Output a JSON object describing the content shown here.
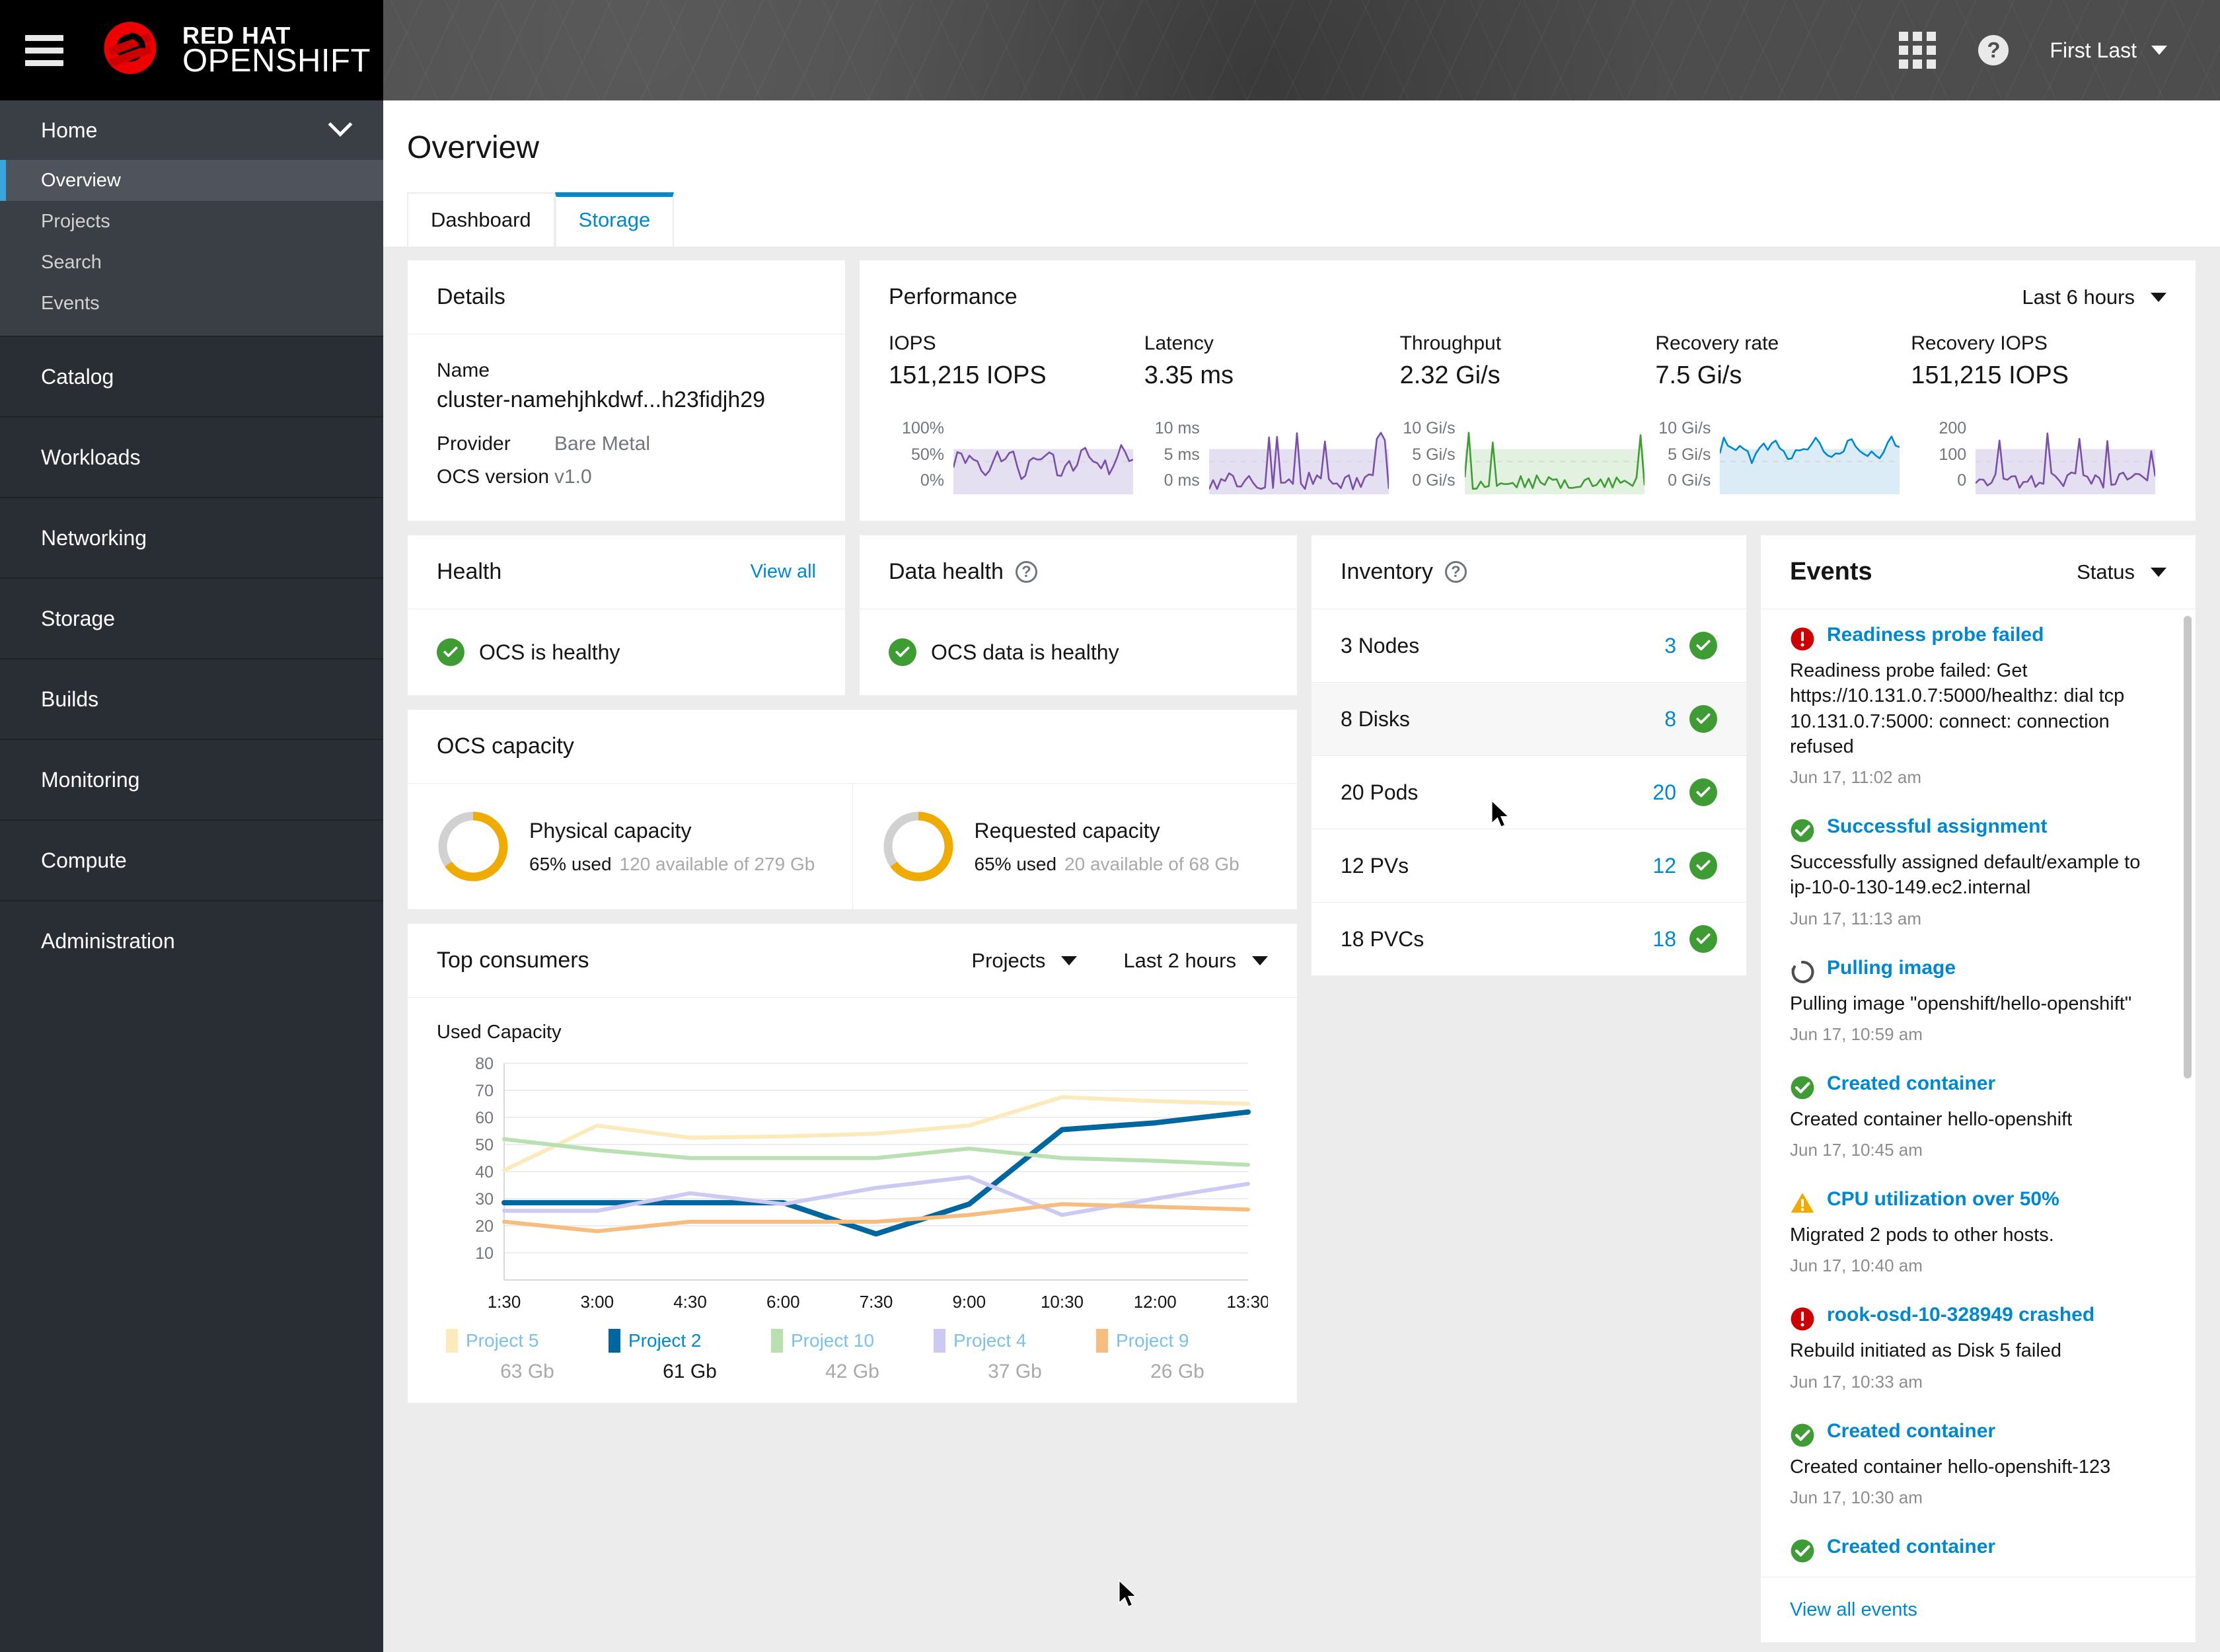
{
  "masthead": {
    "hamburger_icon": "hamburger-icon",
    "brand_line1": "RED HAT",
    "brand_line2": "OPENSHIFT",
    "grid_icon": "application-launcher-icon",
    "help_icon": "help-icon",
    "username": "First Last"
  },
  "sidebar": {
    "group": {
      "label": "Home",
      "chevron": "chevron-down-icon"
    },
    "sub_items": [
      {
        "label": "Overview",
        "active": true
      },
      {
        "label": "Projects",
        "active": false
      },
      {
        "label": "Search",
        "active": false
      },
      {
        "label": "Events",
        "active": false
      }
    ],
    "items": [
      {
        "label": "Catalog"
      },
      {
        "label": "Workloads"
      },
      {
        "label": "Networking"
      },
      {
        "label": "Storage"
      },
      {
        "label": "Builds"
      },
      {
        "label": "Monitoring"
      },
      {
        "label": "Compute"
      },
      {
        "label": "Administration"
      }
    ]
  },
  "page": {
    "title": "Overview",
    "tabs": [
      {
        "label": "Dashboard",
        "active": false
      },
      {
        "label": "Storage",
        "active": true
      }
    ]
  },
  "details": {
    "heading": "Details",
    "name_label": "Name",
    "name_value": "cluster-namehjhkdwf...h23fidjh29",
    "rows": [
      {
        "key": "Provider",
        "value": "Bare Metal"
      },
      {
        "key": "OCS version",
        "value": "v1.0"
      }
    ]
  },
  "performance": {
    "heading": "Performance",
    "time_range": "Last 6 hours",
    "caret_icon": "caret-down-icon",
    "metrics": [
      {
        "label": "IOPS",
        "value": "151,215 IOPS",
        "axis": [
          "100%",
          "50%",
          "0%"
        ],
        "color": "#7b4fa8",
        "fill": "#e4e0f2"
      },
      {
        "label": "Latency",
        "value": "3.35 ms",
        "axis": [
          "10 ms",
          "5 ms",
          "0 ms"
        ],
        "color": "#7b4fa8",
        "fill": "#e4e0f2"
      },
      {
        "label": "Throughput",
        "value": "2.32 Gi/s",
        "axis": [
          "10 Gi/s",
          "5 Gi/s",
          "0 Gi/s"
        ],
        "color": "#3f9c35",
        "fill": "#e3f1e0"
      },
      {
        "label": "Recovery rate",
        "value": "7.5 Gi/s",
        "axis": [
          "10 Gi/s",
          "5 Gi/s",
          "0 Gi/s"
        ],
        "color": "#0088ce",
        "fill": "#dcecf6"
      },
      {
        "label": "Recovery IOPS",
        "value": "151,215 IOPS",
        "axis": [
          "200",
          "100",
          "0"
        ],
        "color": "#7b4fa8",
        "fill": "#e4e0f2"
      }
    ]
  },
  "health": {
    "heading": "Health",
    "view_all": "View all",
    "status_icon": "check-circle-icon",
    "status_text": "OCS is healthy"
  },
  "data_health": {
    "heading": "Data health",
    "help_icon": "help-circle-icon",
    "status_icon": "check-circle-icon",
    "status_text": "OCS data is healthy"
  },
  "capacity": {
    "heading": "OCS capacity",
    "items": [
      {
        "title": "Physical capacity",
        "used_text": "65% used",
        "available_text": "120 available of 279 Gb",
        "percent": 65
      },
      {
        "title": "Requested capacity",
        "used_text": "65% used",
        "available_text": "20 available of 68 Gb",
        "percent": 65
      }
    ],
    "donut_color": "#f0ab00",
    "donut_track": "#d1d1d1"
  },
  "consumers": {
    "heading": "Top consumers",
    "type_filter": "Projects",
    "time_filter": "Last 2 hours",
    "caret_icon": "caret-down-icon",
    "chart_label": "Used Capacity"
  },
  "chart_data": {
    "type": "line",
    "title": "Used Capacity",
    "xlabel": "",
    "ylabel": "",
    "x": [
      "1:30",
      "3:00",
      "4:30",
      "6:00",
      "7:30",
      "9:00",
      "10:30",
      "12:00",
      "13:30"
    ],
    "ylim": [
      0,
      80
    ],
    "yticks": [
      10,
      20,
      30,
      40,
      50,
      60,
      70,
      80
    ],
    "grid": true,
    "legend_position": "bottom",
    "series": [
      {
        "name": "Project 5",
        "total": "63 Gb",
        "color": "#fbeabc",
        "highlight": false,
        "values": [
          40.5,
          57,
          52.5,
          53,
          54,
          57,
          67.5,
          66,
          65
        ]
      },
      {
        "name": "Project 2",
        "total": "61 Gb",
        "color": "#0066a0",
        "highlight": true,
        "values": [
          28.5,
          28.5,
          28.5,
          28.5,
          17,
          28,
          55.5,
          58,
          62
        ]
      },
      {
        "name": "Project 10",
        "total": "42 Gb",
        "color": "#b9e0b0",
        "highlight": false,
        "values": [
          52,
          48,
          45,
          45,
          45,
          48.5,
          45,
          44,
          42.5
        ]
      },
      {
        "name": "Project 4",
        "total": "37 Gb",
        "color": "#ccc9f2",
        "highlight": false,
        "values": [
          25.5,
          25.5,
          32,
          28,
          34,
          38,
          24,
          30,
          35.5
        ]
      },
      {
        "name": "Project 9",
        "total": "26 Gb",
        "color": "#f7bd7f",
        "highlight": false,
        "values": [
          21.5,
          18,
          21.5,
          21.5,
          21.5,
          24,
          28,
          27,
          26
        ]
      }
    ]
  },
  "inventory": {
    "heading": "Inventory",
    "help_icon": "help-circle-icon",
    "rows": [
      {
        "label": "3 Nodes",
        "count": "3",
        "status_icon": "check-circle-icon",
        "hover": false
      },
      {
        "label": "8 Disks",
        "count": "8",
        "status_icon": "check-circle-icon",
        "hover": true
      },
      {
        "label": "20 Pods",
        "count": "20",
        "status_icon": "check-circle-icon",
        "hover": false
      },
      {
        "label": "12 PVs",
        "count": "12",
        "status_icon": "check-circle-icon",
        "hover": false
      },
      {
        "label": "18 PVCs",
        "count": "18",
        "status_icon": "check-circle-icon",
        "hover": false
      }
    ]
  },
  "events": {
    "heading": "Events",
    "filter": "Status",
    "caret_icon": "caret-down-icon",
    "view_all": "View all events",
    "items": [
      {
        "icon": "error-circle-icon",
        "title": "Readiness probe failed",
        "message": "Readiness probe failed: Get https://10.131.0.7:5000/healthz: dial tcp 10.131.0.7:5000: connect: connection refused",
        "time": "Jun 17, 11:02 am"
      },
      {
        "icon": "check-circle-icon",
        "title": "Successful assignment",
        "message": "Successfully assigned default/example to ip-10-0-130-149.ec2.internal",
        "time": "Jun 17, 11:13 am"
      },
      {
        "icon": "in-progress-icon",
        "title": "Pulling image",
        "message": "Pulling image \"openshift/hello-openshift\"",
        "time": "Jun 17, 10:59 am"
      },
      {
        "icon": "check-circle-icon",
        "title": "Created container",
        "message": "Created container hello-openshift",
        "time": "Jun 17, 10:45 am"
      },
      {
        "icon": "warning-triangle-icon",
        "title": "CPU utilization over 50%",
        "message": "Migrated 2 pods to other hosts.",
        "time": "Jun 17, 10:40 am"
      },
      {
        "icon": "error-circle-icon",
        "title": "rook-osd-10-328949 crashed",
        "message": "Rebuild initiated as Disk 5 failed",
        "time": "Jun 17, 10:33 am"
      },
      {
        "icon": "check-circle-icon",
        "title": "Created container",
        "message": "Created container hello-openshift-123",
        "time": "Jun 17, 10:30 am"
      },
      {
        "icon": "check-circle-icon",
        "title": "Created container",
        "message": "",
        "time": ""
      }
    ]
  },
  "colors": {
    "brand_red": "#cc0000",
    "accent_blue": "#0088ce",
    "success_green": "#3f9c35",
    "warning_yellow": "#f0ab00",
    "danger_red": "#cc0000"
  }
}
